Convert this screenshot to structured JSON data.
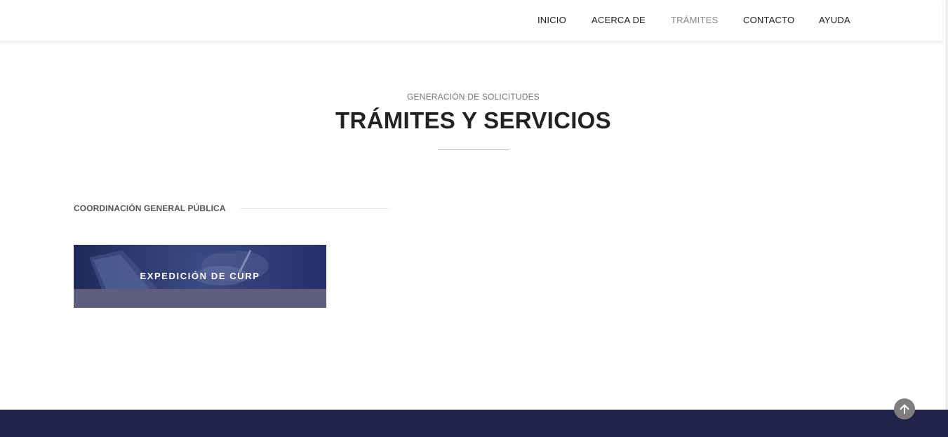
{
  "nav": {
    "items": [
      {
        "label": "INICIO",
        "active": false
      },
      {
        "label": "ACERCA DE",
        "active": false
      },
      {
        "label": "TRÁMITES",
        "active": true
      },
      {
        "label": "CONTACTO",
        "active": false
      },
      {
        "label": "AYUDA",
        "active": false
      }
    ]
  },
  "section": {
    "kicker": "GENERACIÓN DE SOLICITUDES",
    "title": "TRÁMITES Y SERVICIOS"
  },
  "category": {
    "label": "COORDINACIÓN GENERAL PÚBLICA"
  },
  "cards": [
    {
      "title": "EXPEDICIÓN DE CURP",
      "image_icon": "document-signing-photo"
    }
  ],
  "back_to_top": {
    "icon": "arrow-up-icon"
  },
  "colors": {
    "accent_underline": "#c9cc3f",
    "footer": "#22234b",
    "card_overlay": "#2b3a70",
    "active_nav": "#888888"
  }
}
